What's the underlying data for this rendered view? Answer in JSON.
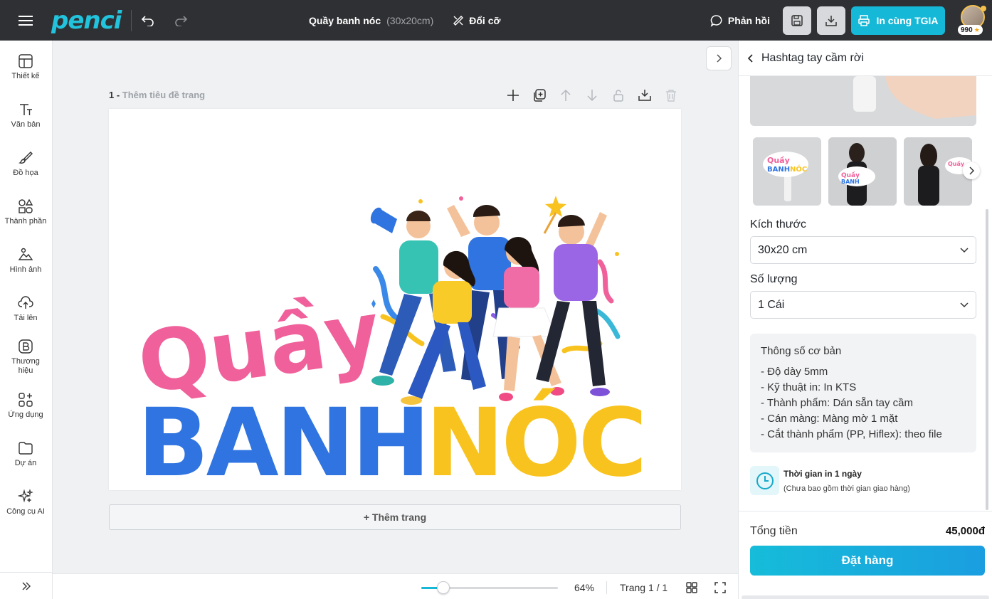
{
  "app": {
    "logo": "penci"
  },
  "header": {
    "doc_title": "Quầy banh nóc",
    "doc_size": "(30x20cm)",
    "resize_label": "Đổi cỡ",
    "feedback_label": "Phản hồi",
    "print_label": "In cùng TGIA",
    "points": "990"
  },
  "sidebar": {
    "items": [
      {
        "label": "Thiết kế",
        "icon": "layout-icon"
      },
      {
        "label": "Văn bản",
        "icon": "text-icon"
      },
      {
        "label": "Đồ họa",
        "icon": "brush-icon"
      },
      {
        "label": "Thành phần",
        "icon": "shapes-icon"
      },
      {
        "label": "Hình ảnh",
        "icon": "image-icon"
      },
      {
        "label": "Tải lên",
        "icon": "upload-icon"
      },
      {
        "label": "Thương hiệu",
        "icon": "brand-icon"
      },
      {
        "label": "Ứng dụng",
        "icon": "apps-icon"
      },
      {
        "label": "Dự án",
        "icon": "folder-icon"
      },
      {
        "label": "Công cụ AI",
        "icon": "sparkle-icon"
      }
    ]
  },
  "canvas": {
    "page_number": "1 -",
    "page_title_placeholder": "Thêm tiêu đề trang",
    "design_text_line1": "Quầy",
    "design_text_line2a": "BANH",
    "design_text_line2b": "NÓC",
    "add_page_label": "+ Thêm trang"
  },
  "bottombar": {
    "zoom_value": 64,
    "zoom_label": "64%",
    "page_count": "Trang 1 / 1"
  },
  "panel": {
    "title": "Hashtag tay cầm rời",
    "size_label": "Kích thước",
    "size_value": "30x20 cm",
    "qty_label": "Số lượng",
    "qty_value": "1 Cái",
    "specs_title": "Thông số cơ bản",
    "specs": [
      "- Độ dày 5mm",
      "- Kỹ thuật in: In KTS",
      "- Thành phẩm: Dán sẵn tay cầm",
      "- Cán màng: Màng mờ 1 mặt",
      "- Cắt thành phẩm (PP, Hiflex): theo file"
    ],
    "time_title": "Thời gian in 1 ngày",
    "time_note": "(Chưa bao gồm thời gian giao hàng)",
    "total_label": "Tổng tiền",
    "total_value": "45,000đ",
    "order_label": "Đặt hàng"
  },
  "colors": {
    "accent": "#16b8d8",
    "topbar": "#2f3033",
    "pink": "#f0609a",
    "blue": "#2f74e0",
    "yellow": "#f9c31f"
  }
}
